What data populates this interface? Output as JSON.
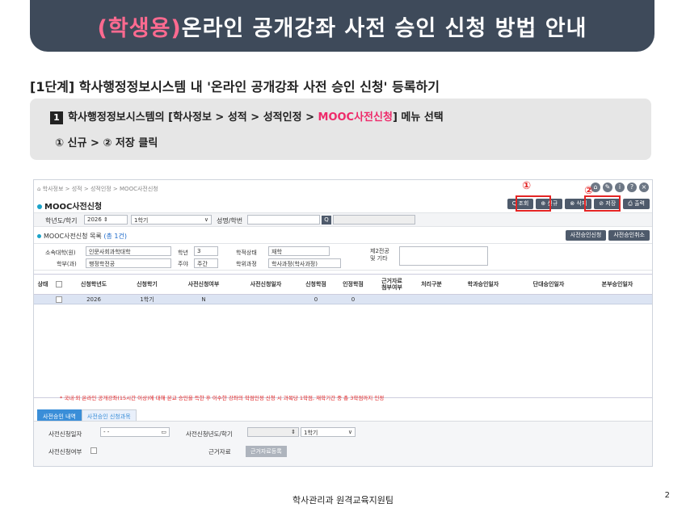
{
  "banner": {
    "highlight": "(학생용)",
    "title": "온라인 공개강좌 사전 승인 신청 방법 안내"
  },
  "step_heading": "[1단계] 학사행정정보시스템 내 '온라인 공개강좌 사전 승인 신청' 등록하기",
  "instruction": {
    "num": "1",
    "prefix": "학사행정정보시스템의 [학사정보 > 성적 > 성적인정 > ",
    "highlight": "MOOC사전신청",
    "suffix": "] 메뉴 선택",
    "line2": "① 신규 > ② 저장 클릭"
  },
  "app": {
    "breadcrumb": "⌂ 학사정보 > 성적 > 성적인정 > MOOC사전신청",
    "title": "MOOC사전신청",
    "buttons": {
      "search": "Q 조회",
      "new": "⊕ 신규",
      "delete": "⊗ 삭제",
      "save": "⊘ 저장",
      "print": "⎙ 출력"
    },
    "markers": {
      "one": "①",
      "two": "②"
    },
    "filter": {
      "year_label": "학년도/학기",
      "year": "2026",
      "term": "1학기",
      "name_label": "성명/학번"
    },
    "list": {
      "label": "MOOC사전신청 목록",
      "count": "(총 1건)",
      "btn_apply": "사전승인신청",
      "btn_cancel": "사전승인취소"
    },
    "info": {
      "college_label": "소속대학(원)",
      "college": "인문사회과학대학",
      "grade_label": "학년",
      "grade": "3",
      "status_label": "학적상태",
      "status": "재학",
      "major2_label": "제2전공\n및 기타",
      "dept_label": "학부(과)",
      "dept": "행정학전공",
      "daynight_label": "주야",
      "daynight": "주간",
      "course_label": "학위과정",
      "course": "학사과정(학사과정)"
    },
    "columns": [
      "상태",
      "",
      "신청학년도",
      "신청학기",
      "사전신청여부",
      "사전신청일자",
      "신청학점",
      "인정학점",
      "근거자료\n첨부여부",
      "처리구분",
      "학과승인일자",
      "단대승인일자",
      "본부승인일자"
    ],
    "row": [
      "",
      "",
      "2026",
      "1학기",
      "N",
      "",
      "0",
      "0",
      "",
      "",
      "",
      "",
      ""
    ],
    "notice": "* 국내·외 온라인 공개강좌(15시간 이상)에 대해 본교 승인을 득한 후 이수한 강좌의 학점인정 신청 시 과목당 1학점, 재학기간 중 총 3학점까지 인정",
    "tabs": [
      "사전승인 내역",
      "사전승인 신청과목"
    ],
    "detail": {
      "date_label": "사전신청일자",
      "date": "- -",
      "year_label": "사전신청년도/학기",
      "term": "1학기",
      "yn_label": "사전신청여부",
      "evidence_label": "근거자료",
      "evidence_btn": "근거자료등록"
    }
  },
  "footer": "학사관리과 원격교육지원팀",
  "page_no": "2"
}
